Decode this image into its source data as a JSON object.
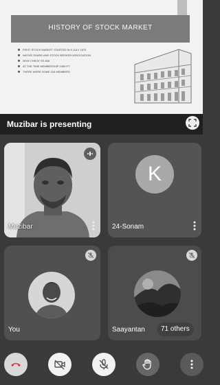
{
  "slide": {
    "title": "HISTORY OF STOCK MARKET",
    "bullets": [
      "First stock market started in 9 JULY 1875",
      "NATIVE SHARE AND STOCK BROKER ASSOCIATION",
      "NOW CHECK ss 836",
      "AT THE TIME MEMBERSHIP 1955 PT",
      "THERE WERE SOME 318 MEMBERS"
    ]
  },
  "presenting": {
    "text": "Muzibar is presenting"
  },
  "tiles": [
    {
      "name": "Muzibar"
    },
    {
      "name": "24-Sonam",
      "initial": "K"
    },
    {
      "name": "You"
    },
    {
      "name": "Saayantan"
    }
  ],
  "others": {
    "label": "71 others"
  },
  "icons": {
    "fullscreen": "fullscreen-icon",
    "speaking": "audio-speaking-icon",
    "muted": "mic-off-icon",
    "more": "more-vert-icon",
    "end_call": "call-end-icon",
    "camera": "videocam-off-icon",
    "mic": "mic-off-icon",
    "hand": "raise-hand-icon"
  }
}
